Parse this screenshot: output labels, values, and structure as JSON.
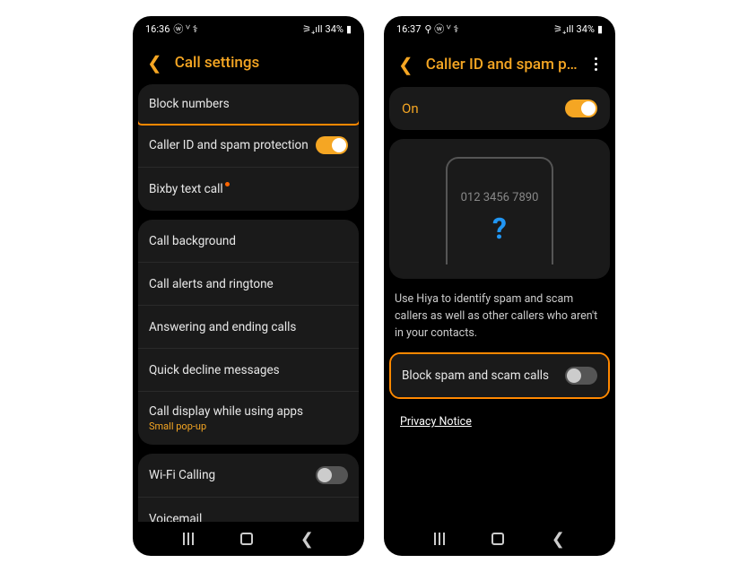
{
  "left": {
    "status": {
      "time": "16:36",
      "icons": "ⓦ ⱽ ⚕",
      "battery": "34%",
      "signal": "⚞₊ıll"
    },
    "title": "Call settings",
    "section1": {
      "block_numbers": "Block numbers",
      "caller_id": "Caller ID and spam protection",
      "bixby": "Bixby text call"
    },
    "section2": {
      "call_bg": "Call background",
      "alerts": "Call alerts and ringtone",
      "answering": "Answering and ending calls",
      "decline": "Quick decline messages",
      "display": "Call display while using apps",
      "display_sub": "Small pop-up"
    },
    "section3": {
      "wifi": "Wi-Fi Calling",
      "voicemail": "Voicemail"
    }
  },
  "right": {
    "status": {
      "time": "16:37",
      "icons": "⚲ ⓦ ⱽ ⚕",
      "battery": "34%",
      "signal": "⚞₊ıll"
    },
    "title": "Caller ID and spam pro…",
    "on_label": "On",
    "phone_number": "012 3456 7890",
    "info_text": "Use Hiya to identify spam and scam callers as well as other callers who aren't in your contacts.",
    "block_spam": "Block spam and scam calls",
    "privacy": "Privacy Notice"
  }
}
